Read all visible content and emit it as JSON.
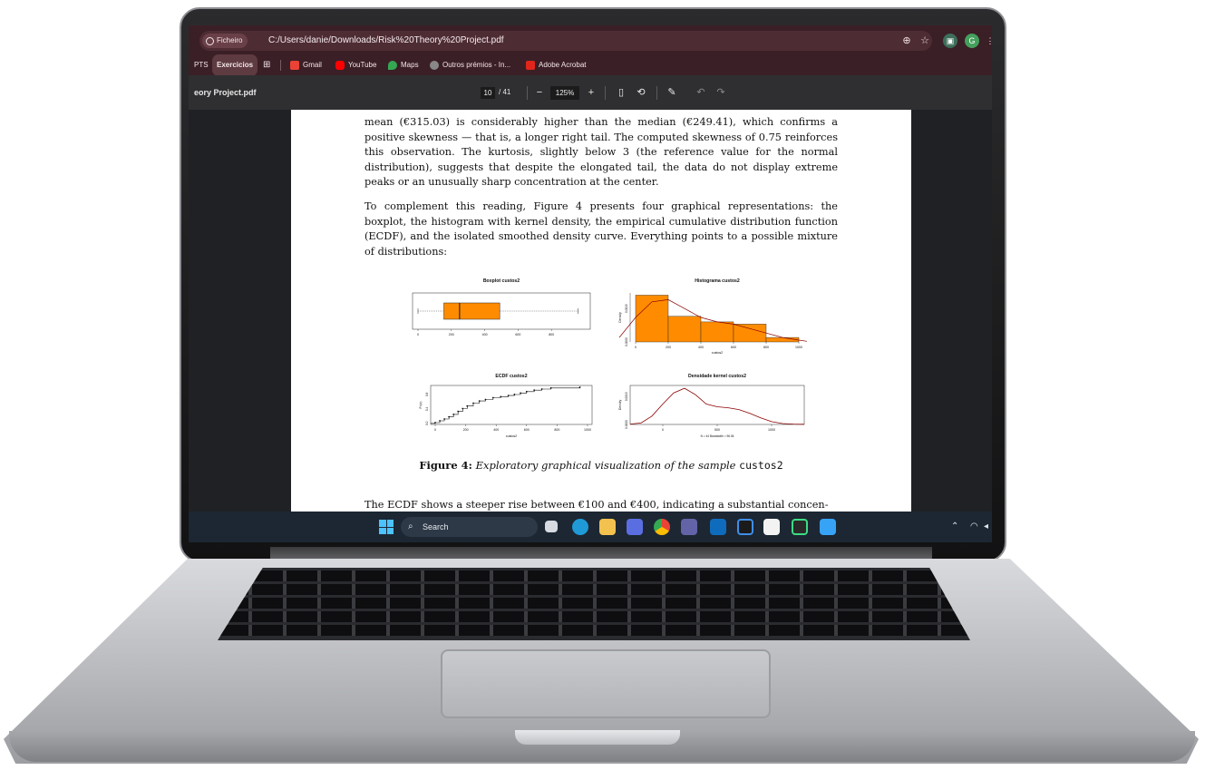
{
  "browser": {
    "file_chip": "Ficheiro",
    "url": "C:/Users/danie/Downloads/Risk%20Theory%20Project.pdf",
    "icons": [
      "zoom-icon",
      "star-icon",
      "extension-icon",
      "profile-icon",
      "menu-icon"
    ]
  },
  "bookmarks": [
    {
      "label": "PTS",
      "icon": "",
      "tagged": false
    },
    {
      "label": "Exercicios",
      "icon": "",
      "tagged": true
    },
    {
      "label": "",
      "icon": "apps-grid-icon",
      "tagged": false
    },
    {
      "label": "Gmail",
      "icon": "gmail-icon",
      "tagged": false
    },
    {
      "label": "YouTube",
      "icon": "youtube-icon",
      "tagged": false
    },
    {
      "label": "Maps",
      "icon": "maps-icon",
      "tagged": false
    },
    {
      "label": "Outros prémios - In...",
      "icon": "site-icon",
      "tagged": false
    },
    {
      "label": "Adobe Acrobat",
      "icon": "acrobat-icon",
      "tagged": false
    }
  ],
  "pdf_toolbar": {
    "title": "eory Project.pdf",
    "current_page": "10",
    "page_total": "/ 41",
    "zoom": "125%",
    "minus": "−",
    "plus": "+"
  },
  "document": {
    "para1": "mean (€315.03) is considerably higher than the median (€249.41), which confirms a positive skewness — that is, a longer right tail. The computed skewness of 0.75 reinforces this observation. The kurtosis, slightly below 3 (the reference value for the normal distribution), suggests that despite the elongated tail, the data do not display extreme peaks or an unusually sharp concentration at the center.",
    "para2": "To complement this reading, Figure 4 presents four graphical representations: the boxplot, the histogram with kernel density, the empirical cumulative distribution function (ECDF), and the isolated smoothed density curve. Everything points to a possible mixture of distributions:",
    "caption_label": "Figure 4:",
    "caption_text": "Exploratory graphical visualization of the sample",
    "caption_var": "custos2",
    "para3": "The ECDF shows a steeper rise between €100 and €400, indicating a substantial concen-"
  },
  "chart_data": [
    {
      "type": "boxplot",
      "title": "Boxplot custos2",
      "x_ticks": [
        "0",
        "200",
        "400",
        "600",
        "800"
      ],
      "xlim": [
        0,
        1000
      ],
      "min": 0,
      "q1": 155,
      "median": 249.41,
      "q3": 490,
      "max": 960,
      "colors": {
        "box": "#ff8c00"
      }
    },
    {
      "type": "bar",
      "title": "Histograma custos2",
      "xlabel": "custos2",
      "ylabel": "Density",
      "y_ticks": [
        "0.0000",
        "0.0015"
      ],
      "x_ticks": [
        "0",
        "200",
        "400",
        "600",
        "800",
        "1000"
      ],
      "xlim": [
        0,
        1000
      ],
      "ylim": [
        0,
        0.0022
      ],
      "bins": [
        0,
        200,
        400,
        600,
        800,
        1000
      ],
      "values": [
        0.0021,
        0.00115,
        0.0009,
        0.0008,
        0.0002
      ],
      "kde_x": [
        -100,
        0,
        100,
        200,
        300,
        400,
        500,
        600,
        700,
        800,
        900,
        1000,
        1050
      ],
      "kde_y": [
        0.0002,
        0.0011,
        0.0018,
        0.0019,
        0.0015,
        0.0011,
        0.0009,
        0.0008,
        0.0006,
        0.0004,
        0.0002,
        8e-05,
        3e-05
      ],
      "colors": {
        "bar": "#ff8c00",
        "kde": "#8b0000"
      }
    },
    {
      "type": "line",
      "title": "ECDF custos2",
      "xlabel": "custos2",
      "ylabel": "Fn(x)",
      "y_ticks": [
        "0.0",
        "0.4",
        "0.8"
      ],
      "x_ticks": [
        "0",
        "200",
        "400",
        "600",
        "800",
        "1000"
      ],
      "xlim": [
        -30,
        1030
      ],
      "ylim": [
        -0.03,
        1.05
      ],
      "x": [
        0,
        30,
        60,
        90,
        120,
        150,
        180,
        210,
        250,
        290,
        330,
        380,
        430,
        480,
        520,
        560,
        600,
        650,
        700,
        760,
        950
      ],
      "y": [
        0.02,
        0.07,
        0.12,
        0.18,
        0.25,
        0.33,
        0.41,
        0.48,
        0.56,
        0.62,
        0.66,
        0.71,
        0.74,
        0.77,
        0.8,
        0.84,
        0.88,
        0.92,
        0.95,
        0.98,
        1.0
      ]
    },
    {
      "type": "line",
      "title": "Densidade kernel custos2",
      "ylabel": "Density",
      "y_ticks": [
        "0.0000",
        "0.0015"
      ],
      "x_ticks": [
        "0",
        "500",
        "1000"
      ],
      "subtitle": "N = 44   Bandwidth = 96.06",
      "xlim": [
        -300,
        1300
      ],
      "ylim": [
        0,
        0.0021
      ],
      "x": [
        -300,
        -200,
        -100,
        0,
        100,
        200,
        300,
        400,
        500,
        600,
        700,
        800,
        900,
        1000,
        1100,
        1200,
        1300
      ],
      "y": [
        2e-05,
        8e-05,
        0.00045,
        0.0011,
        0.0017,
        0.00195,
        0.0016,
        0.0011,
        0.00095,
        0.0009,
        0.0008,
        0.0006,
        0.00035,
        0.00015,
        5e-05,
        2e-05,
        1e-05
      ],
      "colors": {
        "line": "#8b0000"
      }
    }
  ],
  "taskbar": {
    "search_placeholder": "Search",
    "apps": [
      "task-view-icon",
      "edge-icon",
      "file-explorer-icon",
      "store-icon",
      "chrome-icon",
      "teams-icon",
      "outlook-icon",
      "code-icon",
      "notes-icon",
      "terminal-icon",
      "azure-icon"
    ],
    "tray": [
      "chevron-up-icon",
      "wifi-icon",
      "volume-icon"
    ]
  }
}
